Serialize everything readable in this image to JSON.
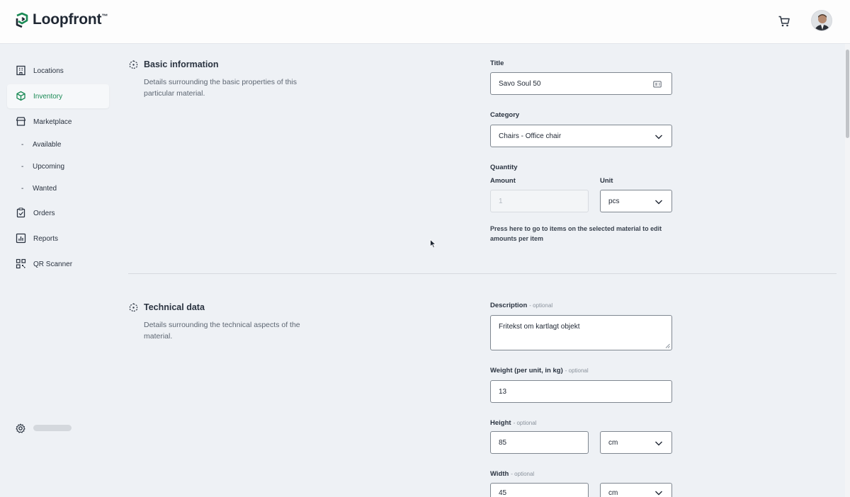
{
  "app": {
    "logo_text": "Loopfront",
    "logo_tm": "™",
    "brand_color": "#1a8a55"
  },
  "header": {
    "cart_icon": "cart-icon",
    "avatar": "user-avatar"
  },
  "sidebar": {
    "items": [
      {
        "label": "Locations",
        "icon": "building-icon"
      },
      {
        "label": "Inventory",
        "icon": "cube-icon",
        "active": true
      },
      {
        "label": "Marketplace",
        "icon": "store-icon"
      },
      {
        "label": "Orders",
        "icon": "clipboard-icon"
      },
      {
        "label": "Reports",
        "icon": "chart-icon"
      },
      {
        "label": "QR Scanner",
        "icon": "qr-icon"
      }
    ],
    "subitems": [
      {
        "dash": "-",
        "label": "Available"
      },
      {
        "dash": "-",
        "label": "Upcoming"
      },
      {
        "dash": "-",
        "label": "Wanted"
      }
    ],
    "settings_icon": "gear-icon"
  },
  "basic": {
    "title": "Basic information",
    "desc": "Details surrounding the basic properties of this particular material.",
    "title_label": "Title",
    "title_value": "Savo Soul 50",
    "category_label": "Category",
    "category_value": "Chairs - Office chair",
    "quantity_label": "Quantity",
    "amount_label": "Amount",
    "amount_value": "1",
    "unit_label": "Unit",
    "unit_value": "pcs",
    "hint": "Press here to go to items on the selected material to edit amounts per item"
  },
  "technical": {
    "title": "Technical data",
    "desc": "Details surrounding the technical aspects of the material.",
    "optional": "- optional",
    "description_label": "Description",
    "description_value": "Fritekst om kartlagt objekt",
    "weight_label": "Weight (per unit, in kg)",
    "weight_value": "13",
    "height_label": "Height",
    "height_value": "85",
    "height_unit": "cm",
    "width_label": "Width",
    "width_value": "45",
    "width_unit": "cm"
  }
}
